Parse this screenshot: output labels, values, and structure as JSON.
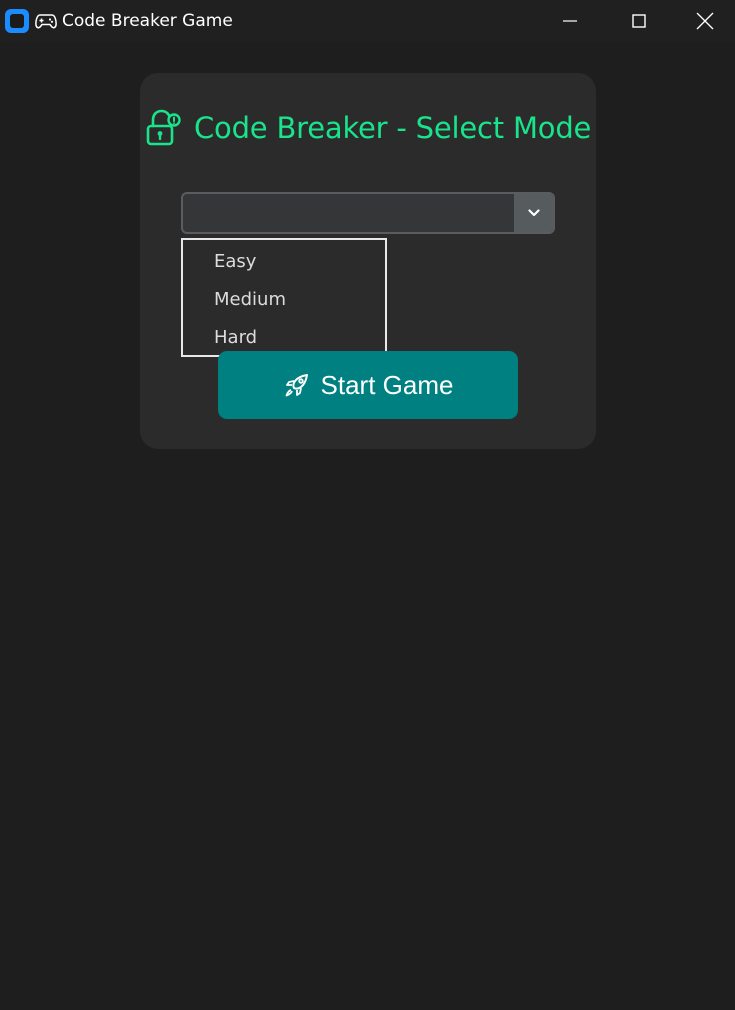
{
  "window": {
    "title": "Code Breaker Game"
  },
  "heading": {
    "text": "Code Breaker - Select Mode"
  },
  "mode_select": {
    "value": "",
    "options": [
      "Easy",
      "Medium",
      "Hard"
    ]
  },
  "start_button": {
    "label": "Start Game"
  },
  "icons": {
    "app": "app-icon",
    "title": "gamepad-icon",
    "heading": "lock-key-icon",
    "select": "chevron-down-icon",
    "button": "rocket-icon"
  },
  "colors": {
    "accent_green": "#19e38b",
    "button_teal": "#008080",
    "background": "#1e1e1e",
    "card": "#2b2b2b"
  }
}
